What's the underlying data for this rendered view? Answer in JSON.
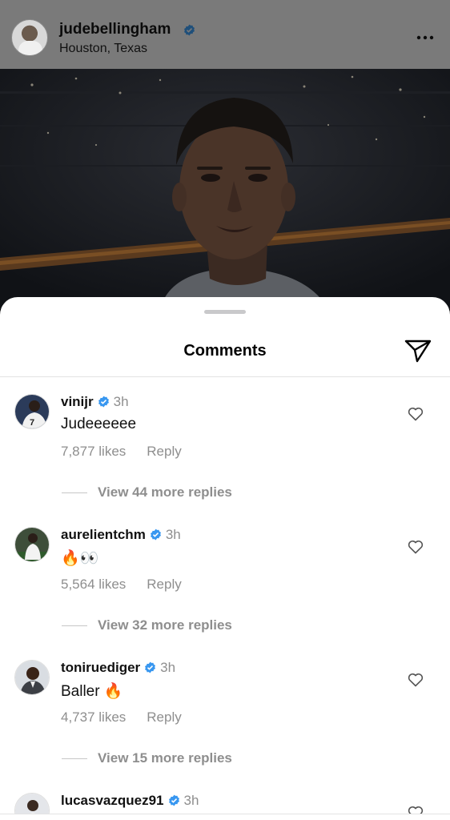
{
  "post": {
    "username": "judebellingham",
    "location": "Houston, Texas"
  },
  "sheet": {
    "title": "Comments"
  },
  "comments": [
    {
      "username": "vinijr",
      "time": "3h",
      "text": "Judeeeeee",
      "likes": "7,877 likes",
      "reply_label": "Reply",
      "view_replies": "View 44 more replies"
    },
    {
      "username": "aurelientchm",
      "time": "3h",
      "text": "🔥👀",
      "likes": "5,564 likes",
      "reply_label": "Reply",
      "view_replies": "View 32 more replies"
    },
    {
      "username": "toniruediger",
      "time": "3h",
      "text": "Baller 🔥",
      "likes": "4,737 likes",
      "reply_label": "Reply",
      "view_replies": "View 15 more replies"
    },
    {
      "username": "lucasvazquez91",
      "time": "3h"
    }
  ],
  "icons": {
    "verified": "verified-badge-icon",
    "more": "more-dots-icon",
    "share": "paper-plane-icon",
    "like": "heart-icon"
  },
  "colors": {
    "verified_blue": "#3897f0",
    "muted_text": "#8e8e8e"
  }
}
